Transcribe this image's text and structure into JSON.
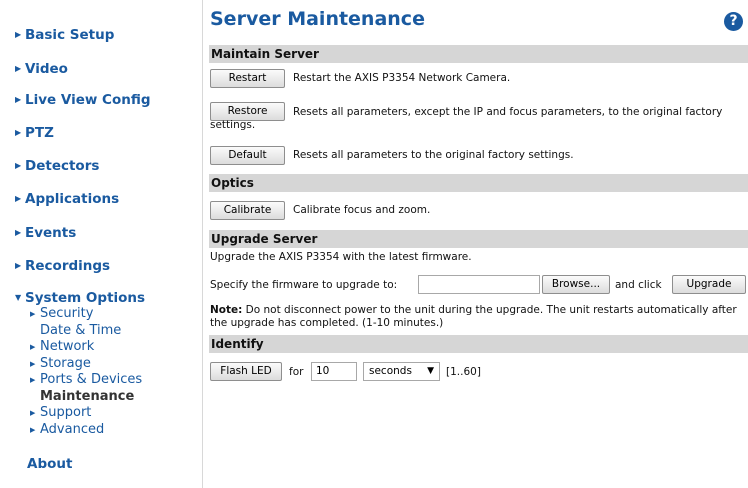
{
  "sidebar": {
    "items": [
      {
        "label": "Basic Setup"
      },
      {
        "label": "Video"
      },
      {
        "label": "Live View Config"
      },
      {
        "label": "PTZ"
      },
      {
        "label": "Detectors"
      },
      {
        "label": "Applications"
      },
      {
        "label": "Events"
      },
      {
        "label": "Recordings"
      },
      {
        "label": "System Options"
      },
      {
        "label": "About"
      }
    ],
    "sub_items": [
      {
        "label": "Security"
      },
      {
        "label": "Date & Time"
      },
      {
        "label": "Network"
      },
      {
        "label": "Storage"
      },
      {
        "label": "Ports & Devices"
      },
      {
        "label": "Maintenance"
      },
      {
        "label": "Support"
      },
      {
        "label": "Advanced"
      }
    ]
  },
  "page": {
    "title": "Server Maintenance",
    "help_icon": "?"
  },
  "sections": {
    "maintain": {
      "heading": "Maintain Server",
      "restart_label": "Restart",
      "restart_text": "Restart the AXIS P3354 Network Camera.",
      "restore_label": "Restore",
      "restore_text": "Resets all parameters, except the IP and focus parameters, to the original factory settings.",
      "default_label": "Default",
      "default_text": "Resets all parameters to the original factory settings."
    },
    "optics": {
      "heading": "Optics",
      "calibrate_label": "Calibrate",
      "calibrate_text": "Calibrate focus and zoom."
    },
    "upgrade": {
      "heading": "Upgrade Server",
      "intro": "Upgrade the AXIS P3354 with the latest firmware.",
      "specify_text": "Specify the firmware to upgrade to:",
      "file_value": "",
      "browse_label": "Browse...",
      "and_click": "and click",
      "upgrade_label": "Upgrade",
      "note_label": "Note:",
      "note_text": " Do not disconnect power to the unit during the upgrade. The unit restarts automatically after the upgrade has completed. (1-10 minutes.)"
    },
    "identify": {
      "heading": "Identify",
      "flash_label": "Flash LED",
      "for_text": "for",
      "duration_value": "10",
      "unit_value": "seconds",
      "range_text": "[1..60]"
    }
  },
  "colors": {
    "link": "#1a5aa0",
    "section_bar": "#d6d6d6"
  }
}
